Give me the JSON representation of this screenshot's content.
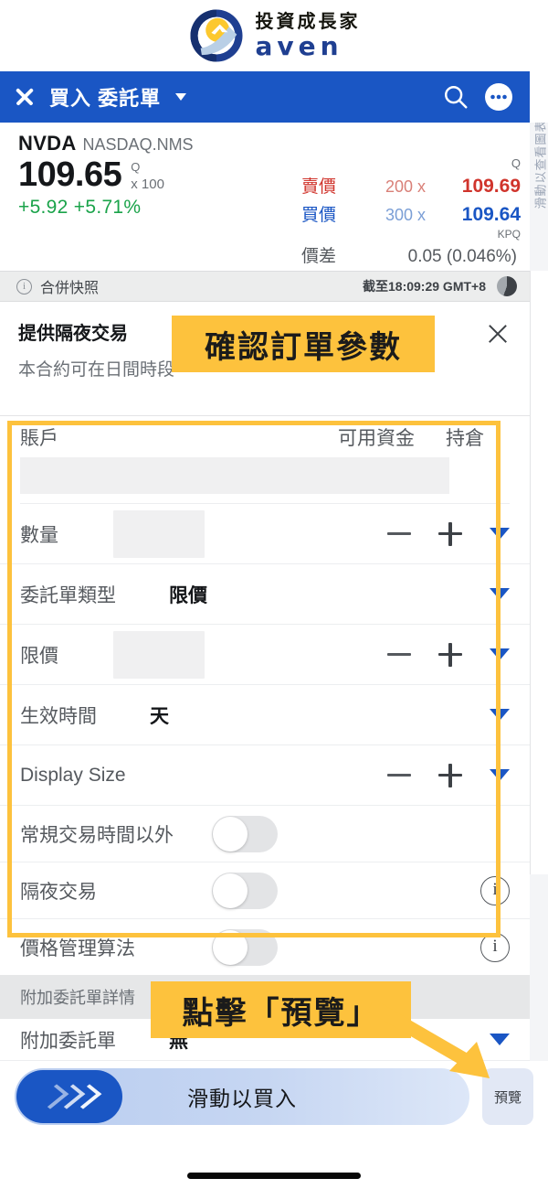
{
  "branding": {
    "cn_name": "投資成長家",
    "en_name": "aven",
    "logo_icon": "aven-circle-logo"
  },
  "appbar": {
    "close_icon": "close-icon",
    "title": "買入 委託單",
    "dropdown_icon": "chevron-down-icon",
    "search_icon": "search-icon",
    "more_icon": "more-options-icon",
    "background": "#1a56c4"
  },
  "quote": {
    "symbol": "NVDA",
    "exchange": "NASDAQ.NMS",
    "last_price": "109.65",
    "last_qualifier": "Q",
    "lot_size": "x 100",
    "change": "+5.92 +5.71%",
    "change_color": "#1aa34a",
    "top_qualifier": "Q",
    "ask_label": "賣價",
    "ask_size": "200 x",
    "ask_price": "109.69",
    "ask_color": "#d0342c",
    "bid_label": "買價",
    "bid_size": "300 x",
    "bid_price": "109.64",
    "bid_color": "#1a56c4",
    "kpq": "KPQ",
    "spread_label": "價差",
    "spread_value": "0.05 (0.046%)"
  },
  "snapshot": {
    "info_icon": "info-icon",
    "label": "合併快照",
    "timestamp": "截至18:09:29 GMT+8",
    "pie_icon": "pie-indicator-icon"
  },
  "overnight": {
    "title": "提供隔夜交易",
    "subtitle": "本合約可在日間時段",
    "close_icon": "close-icon"
  },
  "form": {
    "account": {
      "label": "賬戶",
      "available_funds_label": "可用資金",
      "position_label": "持倉",
      "value": ""
    },
    "rows": [
      {
        "label": "數量",
        "value": "",
        "has_ghost": true,
        "has_stepper": true,
        "has_caret": true
      },
      {
        "label": "委託單類型",
        "value": "限價",
        "has_ghost": false,
        "has_stepper": false,
        "has_caret": true
      },
      {
        "label": "限價",
        "value": "",
        "has_ghost": true,
        "has_stepper": true,
        "has_caret": true
      },
      {
        "label": "生效時間",
        "value": "天",
        "has_ghost": false,
        "has_stepper": false,
        "has_caret": true
      },
      {
        "label": "Display Size",
        "value": "",
        "has_ghost": false,
        "has_stepper": true,
        "has_caret": true
      }
    ],
    "toggles": [
      {
        "label": "常規交易時間以外",
        "state": "off",
        "has_info": false
      },
      {
        "label": "隔夜交易",
        "state": "off",
        "has_info": true
      },
      {
        "label": "價格管理算法",
        "state": "off",
        "has_info": true
      }
    ],
    "minus_icon": "minus-icon",
    "plus_icon": "plus-icon",
    "caret_icon": "chevron-down-icon",
    "info_icon": "info-icon"
  },
  "attached": {
    "section_title": "附加委託單詳情",
    "row_label": "附加委託單",
    "row_value": "無",
    "caret_icon": "chevron-down-icon"
  },
  "rail": {
    "vertical_text": "滑動以查看圖表"
  },
  "action_bar": {
    "slider_label": "滑動以買入",
    "slider_handle_icon": "chevrons-right-icon",
    "preview_label": "預覽"
  },
  "annotations": {
    "confirm_params": "確認訂單參數",
    "click_preview": "點擊「預覽」",
    "highlight_color": "#fdc23d",
    "arrow_icon": "arrow-down-right-icon"
  }
}
